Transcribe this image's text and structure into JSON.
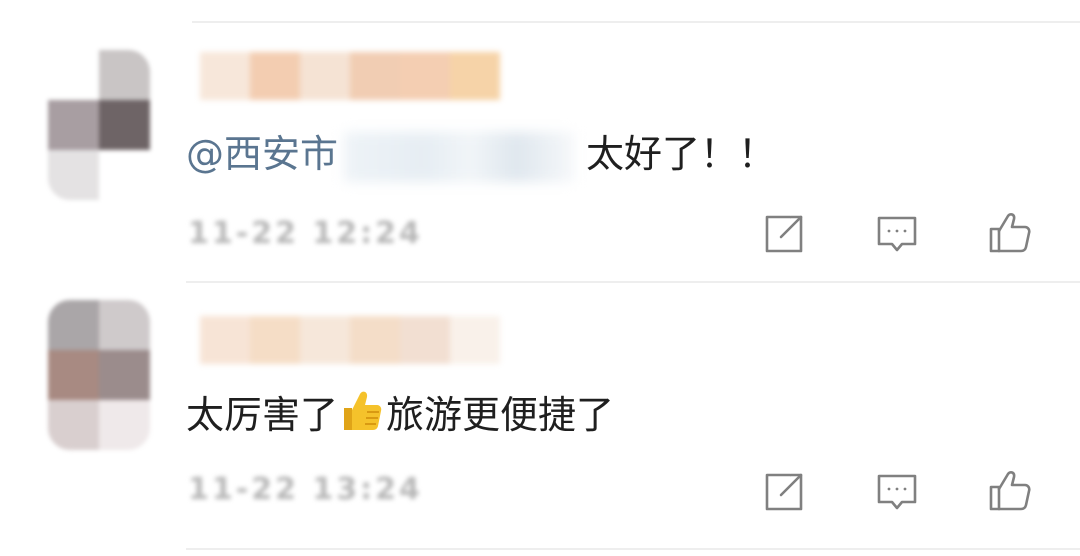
{
  "comments": [
    {
      "mention": "@西安市",
      "text": "太好了！！",
      "time": "11-22 12:24",
      "avatar_colors": [
        "#ffffff",
        "#c9c5c5",
        "#a89ea2",
        "#6e6466",
        "#e4e2e3",
        "#ffffff"
      ],
      "name_colors": [
        "#f7e7da",
        "#f3cdb1",
        "#f5e3d4",
        "#f1cdb3",
        "#f4ceb2",
        "#f6d3a8"
      ]
    },
    {
      "text_before": "太厉害了",
      "emoji": "thumbs-up-emoji",
      "text_after": "旅游更便捷了",
      "time": "11-22 13:24",
      "avatar_colors": [
        "#aaa6a8",
        "#cfcacb",
        "#a88a82",
        "#9b8c8c",
        "#d9cfcf",
        "#efe9ea"
      ],
      "name_colors": [
        "#f7e4d6",
        "#f5ddc6",
        "#f6e7da",
        "#f4ddc8",
        "#f2dfd2",
        "#f9f1ea"
      ]
    }
  ],
  "actions": [
    {
      "name": "share",
      "icon": "share-icon"
    },
    {
      "name": "comment",
      "icon": "comment-icon"
    },
    {
      "name": "like",
      "icon": "thumbs-up-icon"
    }
  ],
  "colors": {
    "mention": "#5a7590",
    "icon": "#808080",
    "divider": "#eeeeee",
    "emoji": "#f5c22b"
  }
}
